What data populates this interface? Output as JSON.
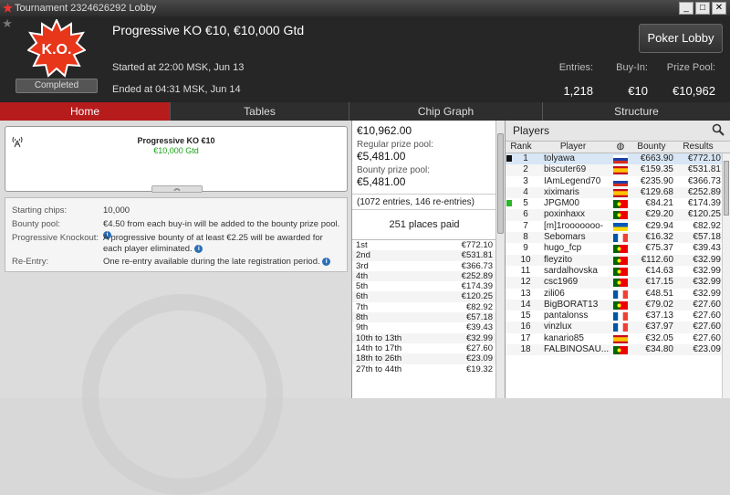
{
  "window": {
    "title": "Tournament 2324626292 Lobby",
    "buttons": [
      "_",
      "□",
      "✕"
    ]
  },
  "header": {
    "logo_text": "K.O.",
    "badge": "Completed",
    "tournament_name": "Progressive KO €10, €10,000 Gtd",
    "started": "Started at 22:00 MSK, Jun 13",
    "ended": "Ended at 04:31 MSK, Jun 14",
    "entries_label": "Entries:",
    "entries_value": "1,218",
    "buyin_label": "Buy-In:",
    "buyin_value": "€10",
    "prizepool_label": "Prize Pool:",
    "prizepool_value": "€10,962",
    "poker_lobby_button": "Poker Lobby"
  },
  "tabs": [
    {
      "label": "Home",
      "active": true
    },
    {
      "label": "Tables"
    },
    {
      "label": "Chip Graph"
    },
    {
      "label": "Structure"
    }
  ],
  "info_box": {
    "title": "Progressive KO €10",
    "subtitle": "€10,000 Gtd",
    "collapse_icon": "double-chevron-up"
  },
  "details": [
    {
      "key": "Starting chips:",
      "value": "10,000"
    },
    {
      "key": "Bounty pool:",
      "value": "€4.50 from each buy-in will be added to the bounty prize pool."
    },
    {
      "key": "Progressive Knockout:",
      "value": "A progressive bounty of at least €2.25 will be awarded for each player eliminated."
    },
    {
      "key": "Re-Entry:",
      "value": "One re-entry available during the late registration period."
    }
  ],
  "prize": {
    "total": "€10,962.00",
    "regular_label": "Regular prize pool:",
    "regular_value": "€5,481.00",
    "bounty_label": "Bounty prize pool:",
    "bounty_value": "€5,481.00",
    "entries_note": "(1072 entries, 146 re-entries)",
    "places_paid": "251 places paid"
  },
  "payouts": [
    [
      "1st",
      "€772.10"
    ],
    [
      "2nd",
      "€531.81"
    ],
    [
      "3rd",
      "€366.73"
    ],
    [
      "4th",
      "€252.89"
    ],
    [
      "5th",
      "€174.39"
    ],
    [
      "6th",
      "€120.25"
    ],
    [
      "7th",
      "€82.92"
    ],
    [
      "8th",
      "€57.18"
    ],
    [
      "9th",
      "€39.43"
    ],
    [
      "10th to 13th",
      "€32.99"
    ],
    [
      "14th to 17th",
      "€27.60"
    ],
    [
      "18th to 26th",
      "€23.09"
    ],
    [
      "27th to 44th",
      "€19.32"
    ]
  ],
  "players": {
    "title": "Players",
    "columns": {
      "rank": "Rank",
      "player": "Player",
      "bounty": "Bounty",
      "results": "Results"
    },
    "rows": [
      {
        "rank": "1",
        "name": "tolyawa",
        "flag": "ru",
        "bounty": "€663.90",
        "result": "€772.10"
      },
      {
        "rank": "2",
        "name": "biscuter69",
        "flag": "es",
        "bounty": "€159.35",
        "result": "€531.81"
      },
      {
        "rank": "3",
        "name": "IAmLegend70",
        "flag": "ru",
        "bounty": "€235.90",
        "result": "€366.73"
      },
      {
        "rank": "4",
        "name": "xiximaris",
        "flag": "es",
        "bounty": "€129.68",
        "result": "€252.89"
      },
      {
        "rank": "5",
        "name": "JPGM00",
        "flag": "pt",
        "bounty": "€84.21",
        "result": "€174.39"
      },
      {
        "rank": "6",
        "name": "poxinhaxx",
        "flag": "pt",
        "bounty": "€29.20",
        "result": "€120.25"
      },
      {
        "rank": "7",
        "name": "[m]1rooooooo-",
        "flag": "ua",
        "bounty": "€29.94",
        "result": "€82.92"
      },
      {
        "rank": "8",
        "name": "Sebomars",
        "flag": "fr",
        "bounty": "€16.32",
        "result": "€57.18"
      },
      {
        "rank": "9",
        "name": "hugo_fcp",
        "flag": "pt",
        "bounty": "€75.37",
        "result": "€39.43"
      },
      {
        "rank": "10",
        "name": "fleyzito",
        "flag": "pt",
        "bounty": "€112.60",
        "result": "€32.99"
      },
      {
        "rank": "11",
        "name": "sardalhovska",
        "flag": "pt",
        "bounty": "€14.63",
        "result": "€32.99"
      },
      {
        "rank": "12",
        "name": "csc1969",
        "flag": "pt",
        "bounty": "€17.15",
        "result": "€32.99"
      },
      {
        "rank": "13",
        "name": "zili06",
        "flag": "fr",
        "bounty": "€48.51",
        "result": "€32.99"
      },
      {
        "rank": "14",
        "name": "BigBORAT13",
        "flag": "pt",
        "bounty": "€79.02",
        "result": "€27.60"
      },
      {
        "rank": "15",
        "name": "pantalonss",
        "flag": "fr",
        "bounty": "€37.13",
        "result": "€27.60"
      },
      {
        "rank": "16",
        "name": "vinzlux",
        "flag": "fr",
        "bounty": "€37.97",
        "result": "€27.60"
      },
      {
        "rank": "17",
        "name": "kanario85",
        "flag": "es",
        "bounty": "€32.05",
        "result": "€27.60"
      },
      {
        "rank": "18",
        "name": "FALBINOSAU...",
        "flag": "pt",
        "bounty": "€34.80",
        "result": "€23.09"
      }
    ]
  }
}
